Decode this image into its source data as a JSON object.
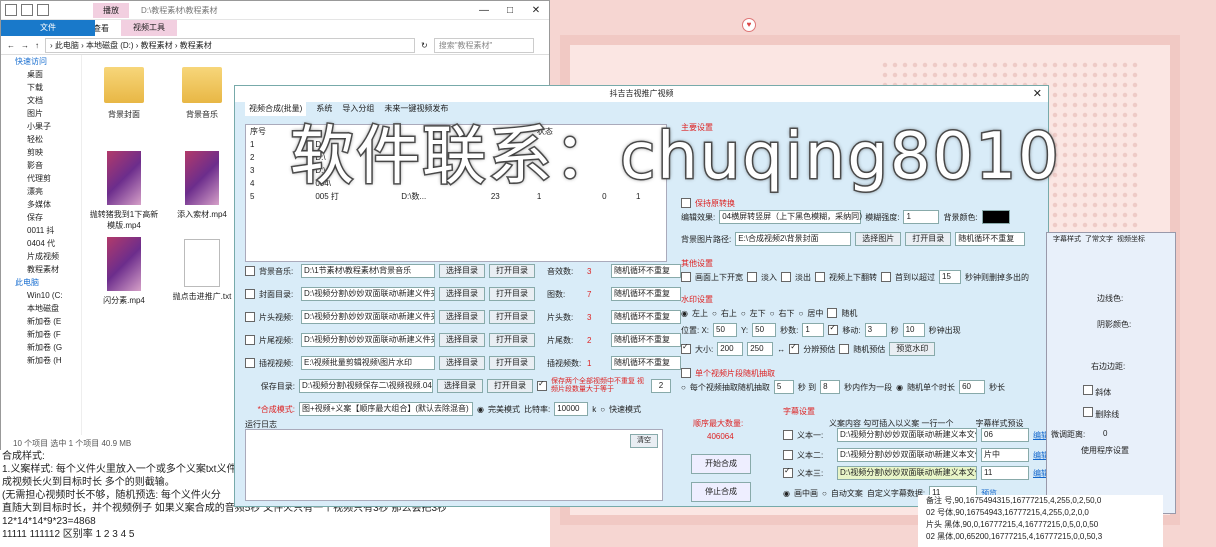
{
  "explorer": {
    "title_path": "D:\\教程素材\\教程素材",
    "tool_tab": "播放",
    "ribbon": [
      "文件",
      "主页",
      "共享",
      "查看",
      "视频工具"
    ],
    "address": "› 此电脑 › 本地磁盘 (D:) › 教程素材 › 教程素材",
    "search_placeholder": "搜索\"教程素材\"",
    "nav_quick": "快速访问",
    "nav_items": [
      "桌面",
      "下载",
      "文档",
      "图片",
      "小果子",
      "轻松",
      "剪映",
      "影音",
      "代理剪",
      "漂亮",
      "多媒体",
      "保存",
      "0011 抖",
      "0404 代",
      "片成视频",
      "教程素材"
    ],
    "nav_pc": "此电脑",
    "nav_drives": [
      "Win10 (C:",
      "本地磁盘",
      "新加卷 (E",
      "新加卷 (F",
      "新加卷 (G",
      "新加卷 (H"
    ],
    "files": [
      {
        "name": "背景封面",
        "kind": "folder"
      },
      {
        "name": "背景音乐",
        "kind": "folder"
      },
      {
        "name": "抛转猪我到1下高新模版.mp4",
        "kind": "video"
      },
      {
        "name": "添入索材.mp4",
        "kind": "video"
      },
      {
        "name": "闪分素.mp4",
        "kind": "video"
      },
      {
        "name": "抛点击进推广.txt",
        "kind": "doc"
      }
    ],
    "status": "10 个项目   选中 1 个项目 40.9 MB"
  },
  "bottom_text": [
    "合成样式:",
    "1.义案样式: 每个义件火里放入一个或多个义案txt义件",
    "成视频长火到目标时长 多个的则截输。",
    "(无需担心视频时长不够，随机预选: 每个义件火分",
    "直随大到目标时长，并个视频例子 如果义案合成的音频5秒 文件火只有一个视频只有3秒 那么会把3秒",
    "12*14*14*9*23=4868",
    "11111  111112  区别率  1 2 3 4 5"
  ],
  "app": {
    "title": "抖吉吉视推广视频",
    "tabs": [
      "视频合成(批量)",
      "系统",
      "导入分组",
      "未来一键视频发布"
    ],
    "table_headers": [
      "序号",
      "",
      "",
      "",
      "状态"
    ],
    "table_rows": [
      [
        "1",
        "D:\\",
        "",
        "",
        ""
      ],
      [
        "2",
        "D:\\",
        "",
        "",
        ""
      ],
      [
        "3",
        "D:\\",
        "",
        "",
        ""
      ],
      [
        "4",
        "004\\",
        "",
        "",
        ""
      ],
      [
        "5",
        "005 打",
        "D:\\数...",
        "23",
        "1",
        "0",
        "1"
      ]
    ],
    "rows": [
      {
        "label": "背景音乐:",
        "path": "D:\\1节素材\\教程素材\\背景音乐",
        "count_label": "音效数:",
        "count": "3",
        "mode": "随机循环不重复"
      },
      {
        "label": "封面目录:",
        "path": "D:\\视频分割\\妙妙双面联动\\新建义件夹",
        "count_label": "图数:",
        "count": "7",
        "mode": "随机循环不重复"
      },
      {
        "label": "片头视频:",
        "path": "D:\\视频分割\\妙妙双面联动\\新建义件夹",
        "count_label": "片头数:",
        "count": "3",
        "mode": "随机循环不重复"
      },
      {
        "label": "片尾视频:",
        "path": "D:\\视频分割\\妙妙双面联动\\新建义件夹",
        "count_label": "片尾数:",
        "count": "2",
        "mode": "随机循环不重复"
      },
      {
        "label": "插视视频:",
        "path": "E:\\视频批量剪辑视频\\图片水印",
        "count_label": "插视频数:",
        "count": "1",
        "mode": "随机循环不重复"
      }
    ],
    "btn_select": "选择目录",
    "btn_open": "打开目录",
    "save_label": "保存目录:",
    "save_path": "D:\\视频分割\\视频保存二\\视频视频.040",
    "save_check": "保存两个全部视频中不重复 视频片段数量大于等于",
    "save_num": "2",
    "mode_label": "*合成模式:",
    "mode_value": "图+视频+义案【顺序最大组合】(默认去除混音)",
    "fast_mode": "完美模式",
    "bitrate_label": "比特率:",
    "bitrate": "10000",
    "bitrate_unit": "k",
    "quick_mode": "快速模式",
    "log_label": "运行日志",
    "log_clear": "清空",
    "seq_label": "顺序最大数量:",
    "seq_value": "406064",
    "start_btn": "开始合成",
    "stop_btn": "停止合成",
    "main_set": "主要设置",
    "keep_size": "保持原转换",
    "codec_label": "编辑效果:",
    "codec_value": "04横屏转竖屏（上下黑色模糊，采纳同）",
    "ratio_label": "模糊强度:",
    "ratio_value": "1",
    "bgcolor_label": "背景颜色:",
    "cover_path_label": "背景图片路径:",
    "cover_path": "E:\\合成视频2\\背景封面",
    "btn_pic": "选择图片",
    "btn_dir": "打开目录",
    "cover_mode": "随机循环不重复",
    "other_set": "其他设置",
    "other_opts": [
      "画面上下开宽",
      "淡入",
      "淡出",
      "视频上下翻转",
      "首到以超过"
    ],
    "other_num": "15",
    "other_tail": "秒钟则删掉多出的",
    "wm_set": "水印设置",
    "wm_pos": [
      "左上",
      "右上",
      "左下",
      "右下",
      "居中",
      "随机"
    ],
    "pos_label": "位置: X:",
    "x": "50",
    "y_label": "Y:",
    "y": "50",
    "shift_label": "秒数:",
    "shift": "1",
    "move_label": "移动:",
    "move": "3",
    "move2_label": "秒",
    "move3": "10",
    "tail_label": "秒钟出现",
    "size_label": "大小:",
    "w": "200",
    "h": "250",
    "adaptive": "分辨预估",
    "random_pos": "随机预估",
    "preview_wm": "预览水印",
    "single_pick": "单个视频片段随机抽取",
    "every_sec": "每个视频抽取随机抽取",
    "from": "5",
    "to_label": "秒 到",
    "to": "8",
    "between": "秒内作为一段",
    "random_len": "随机单个时长",
    "len": "60",
    "len_unit": "秒长",
    "text_set": "字幕设置",
    "text_content": "义案内容 勾可插入以义案 一行一个",
    "text_style": "字幕样式预设",
    "text_rows": [
      {
        "label": "义本一:",
        "path": "D:\\视频分割\\妙妙双面联动\\新建义本文件夹",
        "size": "06",
        "link": "编辑"
      },
      {
        "label": "义本二:",
        "path": "D:\\视频分割\\妙妙双面联动\\新建义本文件夹",
        "size": "片中",
        "link": "编辑"
      },
      {
        "label": "义本三:",
        "path": "D:\\视频分割\\妙妙双面联动\\新建义本文件夹",
        "size": "11",
        "link": "编辑"
      }
    ],
    "pip": "画中画",
    "auto_text": "自动文案",
    "text_sync": "自定义字幕数据:",
    "text_sync_val": "11",
    "text_sync_link": "预览"
  },
  "watermark": "软件联系：chuqing8010",
  "rpanel": {
    "tabs": [
      "字幕样式",
      "了常文字",
      "视频坐标"
    ],
    "items": [
      "边线色:",
      "阴影颜色:",
      "右边边距:",
      "斜体",
      "删除线",
      "微调距离:",
      "使用程序设置"
    ],
    "num": "0"
  },
  "bottom_table": [
    [
      "备注",
      "号,90,1675494315,16777215,4,255,0,2,50,0"
    ],
    [
      "02",
      "号体,90,16754943,16777215,4,255,0,2,0,0"
    ],
    [
      "片头",
      "黑体,90,0,16777215,4,16777215,0,5,0,0,50"
    ],
    [
      "02",
      "黑体,00,65200,16777215,4,16777215,0,0,50,3"
    ]
  ]
}
